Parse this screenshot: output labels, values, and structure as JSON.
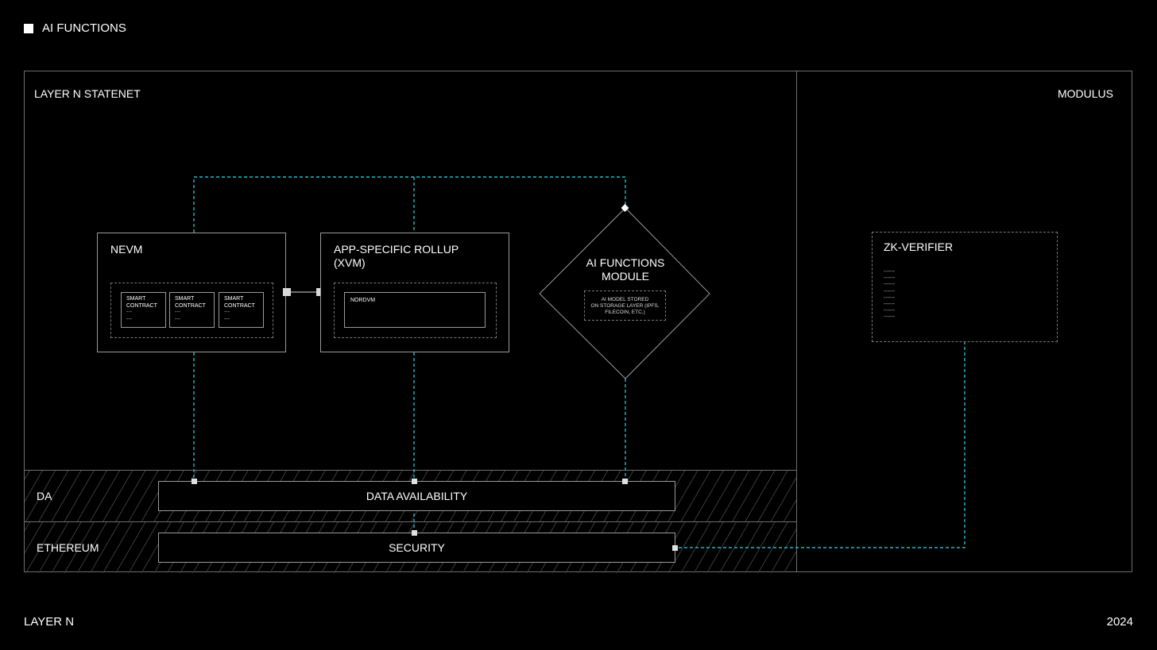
{
  "header": {
    "title": "AI FUNCTIONS"
  },
  "footer": {
    "left": "LAYER N",
    "right": "2024"
  },
  "statenet": {
    "label": "LAYER N STATENET"
  },
  "modulus": {
    "label": "MODULUS"
  },
  "nevm": {
    "title": "NEVM",
    "contracts": [
      {
        "line1": "SMART",
        "line2": "CONTRACT",
        "dash1": "---",
        "dash2": "---"
      },
      {
        "line1": "SMART",
        "line2": "CONTRACT",
        "dash1": "---",
        "dash2": "---"
      },
      {
        "line1": "SMART",
        "line2": "CONTRACT",
        "dash1": "---",
        "dash2": "---"
      }
    ]
  },
  "rollup": {
    "title_line1": "APP-SPECIFIC ROLLUP",
    "title_line2": "(XVM)",
    "inner_label": "NORDVM"
  },
  "ai_module": {
    "title_line1": "AI FUNCTIONS",
    "title_line2": "MODULE",
    "storage_line1": "AI MODEL STORED",
    "storage_line2": "ON STORAGE LAYER (IPFS,",
    "storage_line3": "FILECOIN, ETC.)"
  },
  "zk_verifier": {
    "title": "ZK-VERIFIER",
    "lines": [
      "------",
      "------",
      "------",
      "------",
      "------",
      "------",
      "------",
      "------"
    ]
  },
  "rows": {
    "da": {
      "label": "DA",
      "bar": "DATA AVAILABILITY"
    },
    "ethereum": {
      "label": "ETHEREUM",
      "bar": "SECURITY"
    }
  },
  "colors": {
    "background": "#000000",
    "line": "#6e6e6e",
    "accent_dashed": "#2bb5c6",
    "text": "#ffffff"
  }
}
